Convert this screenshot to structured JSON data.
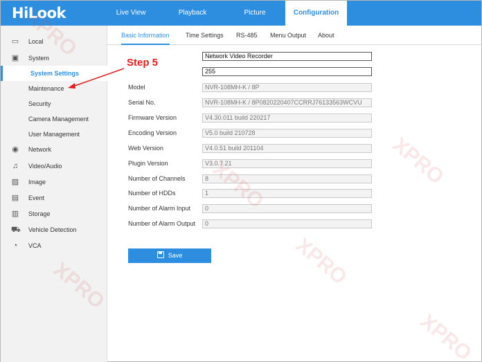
{
  "brand": {
    "logo": "HiLook"
  },
  "topnav": [
    {
      "label": "Live View"
    },
    {
      "label": "Playback"
    },
    {
      "label": "Picture"
    },
    {
      "label": "Configuration"
    }
  ],
  "sidebar": [
    {
      "label": "Local",
      "icon": "monitor-icon"
    },
    {
      "label": "System",
      "icon": "system-icon"
    },
    {
      "label": "System Settings"
    },
    {
      "label": "Maintenance"
    },
    {
      "label": "Security"
    },
    {
      "label": "Camera Management"
    },
    {
      "label": "User Management"
    },
    {
      "label": "Network",
      "icon": "globe-icon"
    },
    {
      "label": "Video/Audio",
      "icon": "video-audio-icon"
    },
    {
      "label": "Image",
      "icon": "image-icon"
    },
    {
      "label": "Event",
      "icon": "event-icon"
    },
    {
      "label": "Storage",
      "icon": "storage-icon"
    },
    {
      "label": "Vehicle Detection",
      "icon": "vehicle-icon"
    },
    {
      "label": "VCA",
      "icon": "vca-icon"
    }
  ],
  "tabs": [
    {
      "label": "Basic Information"
    },
    {
      "label": "Time Settings"
    },
    {
      "label": "RS-485"
    },
    {
      "label": "Menu Output"
    },
    {
      "label": "About"
    }
  ],
  "form": {
    "device_name": "Network Video Recorder",
    "device_no": "255",
    "rows": [
      {
        "label": "Model",
        "value": "NVR-108MH-K / 8P"
      },
      {
        "label": "Serial No.",
        "value": "NVR-108MH-K / 8P0820220407CCRRJ76133563WCVU"
      },
      {
        "label": "Firmware Version",
        "value": "V4.30.011 build 220217"
      },
      {
        "label": "Encoding Version",
        "value": "V5.0 build 210728"
      },
      {
        "label": "Web Version",
        "value": "V4.0.51 build 201104"
      },
      {
        "label": "Plugin Version",
        "value": "V3.0.7.21"
      },
      {
        "label": "Number of Channels",
        "value": "8"
      },
      {
        "label": "Number of HDDs",
        "value": "1"
      },
      {
        "label": "Number of Alarm Input",
        "value": "0"
      },
      {
        "label": "Number of Alarm Output",
        "value": "0"
      }
    ]
  },
  "save_label": "Save",
  "annotation": {
    "step": "Step 5"
  },
  "watermark": {
    "text": "XPRO"
  },
  "colors": {
    "accent": "#2d8ee0",
    "annotation": "#e02020"
  }
}
